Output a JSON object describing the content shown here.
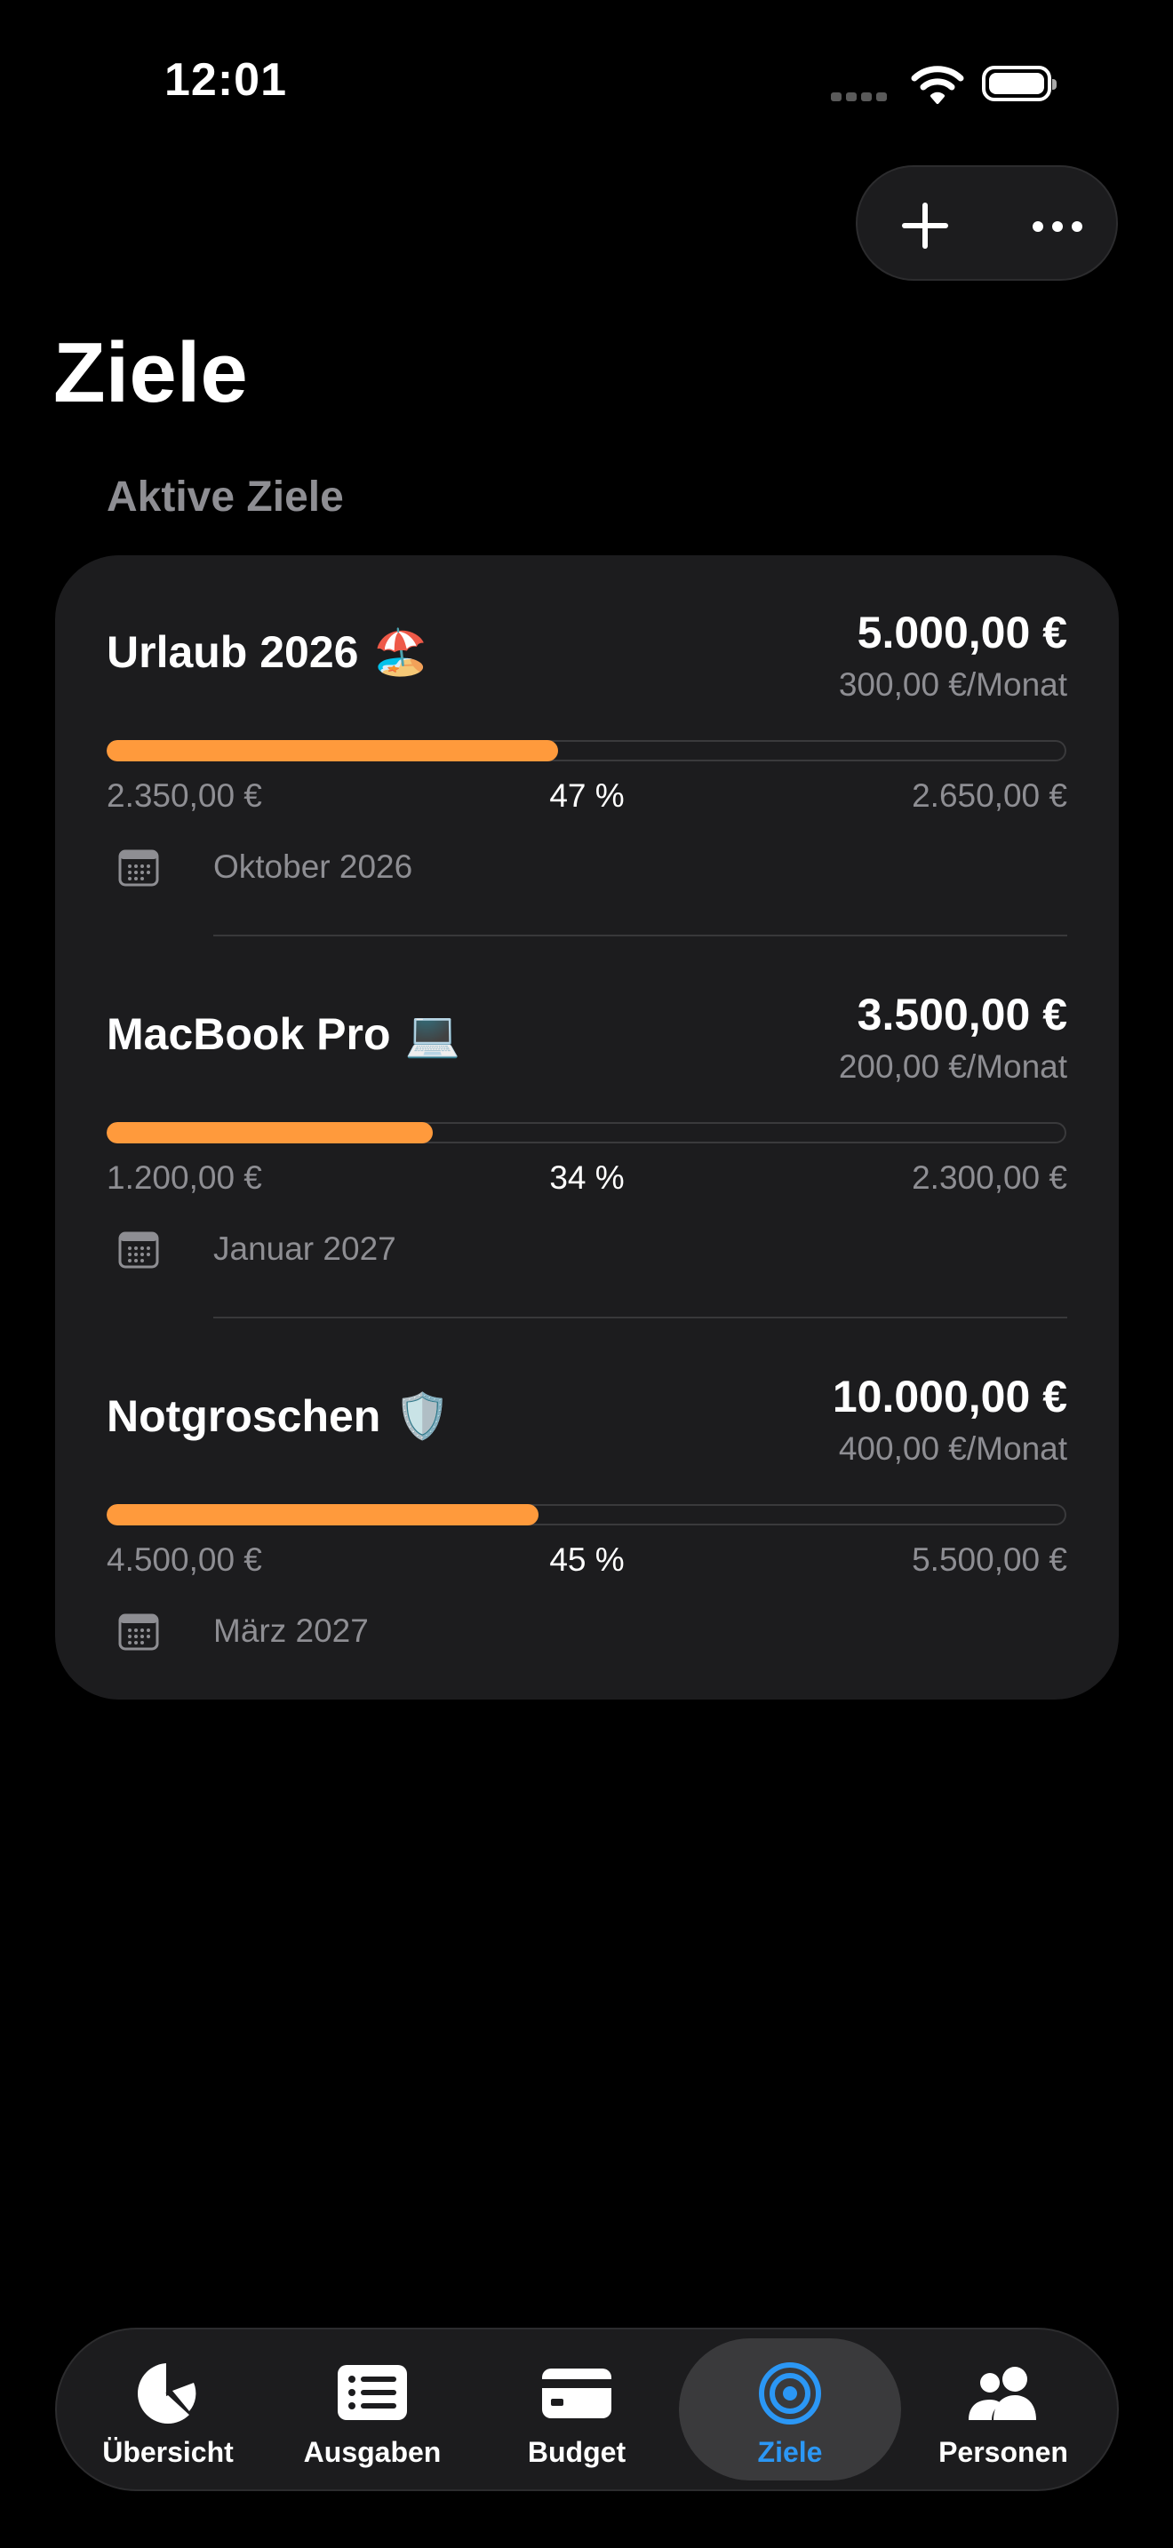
{
  "status_bar": {
    "time": "12:01"
  },
  "page": {
    "title": "Ziele",
    "section_label": "Aktive Ziele"
  },
  "goals": [
    {
      "name": "Urlaub 2026",
      "emoji": "🏖️",
      "target": "5.000,00 €",
      "monthly": "300,00 €/Monat",
      "saved": "2.350,00 €",
      "percent": "47 %",
      "progress": 0.47,
      "remaining": "2.650,00 €",
      "date": "Oktober 2026"
    },
    {
      "name": "MacBook Pro",
      "emoji": "💻",
      "target": "3.500,00 €",
      "monthly": "200,00 €/Monat",
      "saved": "1.200,00 €",
      "percent": "34 %",
      "progress": 0.34,
      "remaining": "2.300,00 €",
      "date": "Januar 2027"
    },
    {
      "name": "Notgroschen",
      "emoji": "🛡️",
      "target": "10.000,00 €",
      "monthly": "400,00 €/Monat",
      "saved": "4.500,00 €",
      "percent": "45 %",
      "progress": 0.45,
      "remaining": "5.500,00 €",
      "date": "März 2027"
    }
  ],
  "tabs": [
    {
      "label": "Übersicht",
      "icon": "pie-chart-icon"
    },
    {
      "label": "Ausgaben",
      "icon": "list-icon"
    },
    {
      "label": "Budget",
      "icon": "credit-card-icon"
    },
    {
      "label": "Ziele",
      "icon": "target-icon",
      "active": true
    },
    {
      "label": "Personen",
      "icon": "people-icon"
    }
  ],
  "colors": {
    "accent": "#2b97f5",
    "progress": "#ff9a3c",
    "card": "#1c1c1e",
    "background": "#000000",
    "secondary_text": "#8e8e93"
  }
}
